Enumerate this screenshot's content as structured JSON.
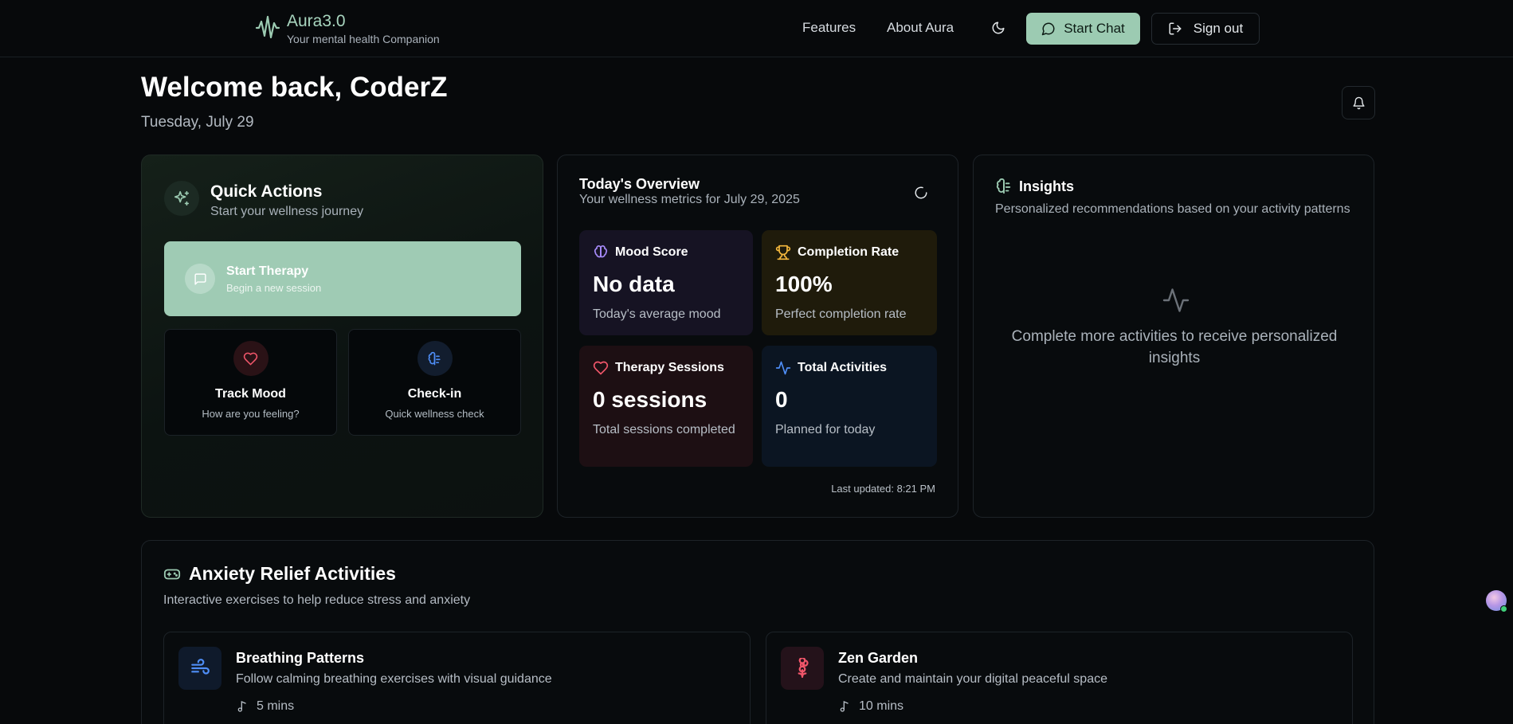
{
  "header": {
    "brand_name": "Aura3.0",
    "brand_tagline": "Your mental health Companion",
    "logo_icon": "soundwave-icon",
    "nav": [
      "Features",
      "About Aura"
    ],
    "theme_toggle_icon": "moon-icon",
    "start_chat_label": "Start Chat",
    "sign_out_label": "Sign out",
    "accent_color": "#9ccbb2"
  },
  "welcome": {
    "title": "Welcome back, CoderZ",
    "date": "Tuesday, July 29",
    "notifications_icon": "bell-icon"
  },
  "quick_actions": {
    "title": "Quick Actions",
    "subtitle": "Start your wellness journey",
    "primary": {
      "title": "Start Therapy",
      "subtitle": "Begin a new session",
      "icon": "message-icon"
    },
    "track_mood": {
      "title": "Track Mood",
      "subtitle": "How are you feeling?",
      "icon": "heart-icon"
    },
    "check_in": {
      "title": "Check-in",
      "subtitle": "Quick wellness check",
      "icon": "brain-icon"
    }
  },
  "overview": {
    "title": "Today's Overview",
    "subtitle": "Your wellness metrics for July 29, 2025",
    "metrics": {
      "mood": {
        "label": "Mood Score",
        "value": "No data",
        "desc": "Today's average mood",
        "color": "#a78bfa"
      },
      "completion": {
        "label": "Completion Rate",
        "value": "100%",
        "desc": "Perfect completion rate",
        "color": "#f5b83d"
      },
      "therapy": {
        "label": "Therapy Sessions",
        "value": "0 sessions",
        "desc": "Total sessions completed",
        "color": "#f0566a"
      },
      "activities": {
        "label": "Total Activities",
        "value": "0",
        "desc": "Planned for today",
        "color": "#4f8ef7"
      }
    },
    "last_updated": "Last updated: 8:21 PM"
  },
  "insights": {
    "title": "Insights",
    "subtitle": "Personalized recommendations based on your activity patterns",
    "empty_text": "Complete more activities to receive personalized insights"
  },
  "anxiety": {
    "title": "Anxiety Relief Activities",
    "subtitle": "Interactive exercises to help reduce stress and anxiety",
    "activities": [
      {
        "title": "Breathing Patterns",
        "desc": "Follow calming breathing exercises with visual guidance",
        "duration": "5 mins",
        "icon": "wind-icon"
      },
      {
        "title": "Zen Garden",
        "desc": "Create and maintain your digital peaceful space",
        "duration": "10 mins",
        "icon": "flower-icon"
      }
    ]
  }
}
